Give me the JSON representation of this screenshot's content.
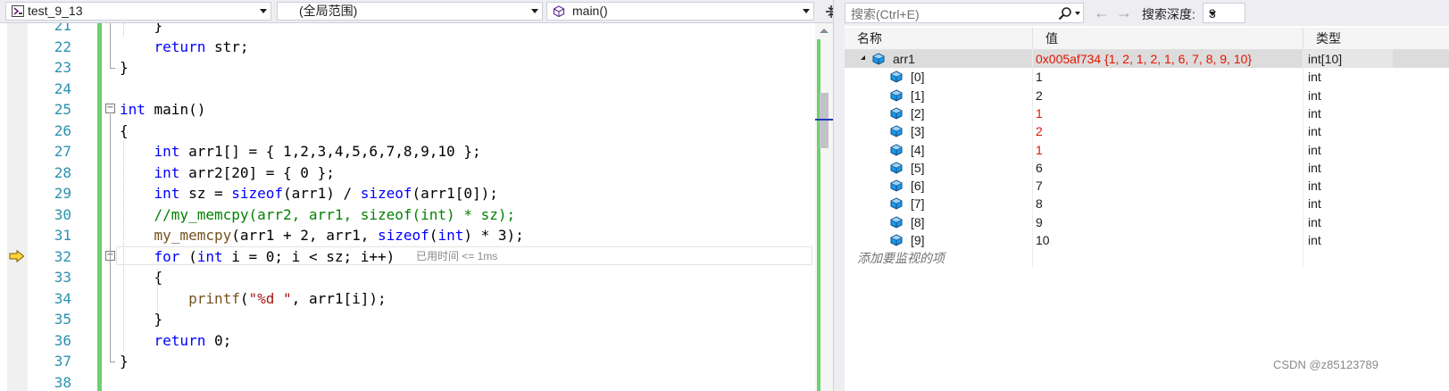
{
  "navbar": {
    "project": "test_9_13",
    "scope": "(全局范围)",
    "function": "main()"
  },
  "code": {
    "lines": [
      {
        "num": "21",
        "text": "    }",
        "partial": true
      },
      {
        "num": "22",
        "text": "    return str;"
      },
      {
        "num": "23",
        "text": "}"
      },
      {
        "num": "24",
        "text": ""
      },
      {
        "num": "25",
        "text": "int main()"
      },
      {
        "num": "26",
        "text": "{"
      },
      {
        "num": "27",
        "text": "    int arr1[] = { 1,2,3,4,5,6,7,8,9,10 };"
      },
      {
        "num": "28",
        "text": "    int arr2[20] = { 0 };"
      },
      {
        "num": "29",
        "text": "    int sz = sizeof(arr1) / sizeof(arr1[0]);"
      },
      {
        "num": "30",
        "text": "    //my_memcpy(arr2, arr1, sizeof(int) * sz);"
      },
      {
        "num": "31",
        "text": "    my_memcpy(arr1 + 2, arr1, sizeof(int) * 3);"
      },
      {
        "num": "32",
        "text": "    for (int i = 0; i < sz; i++)"
      },
      {
        "num": "33",
        "text": "    {"
      },
      {
        "num": "34",
        "text": "        printf(\"%d \", arr1[i]);"
      },
      {
        "num": "35",
        "text": "    }"
      },
      {
        "num": "36",
        "text": "    return 0;"
      },
      {
        "num": "37",
        "text": "}"
      },
      {
        "num": "38",
        "text": "",
        "partial": true
      }
    ],
    "current_line": "32",
    "perf_tip": "已用时间 <= 1ms"
  },
  "watch": {
    "search_placeholder": "搜索(Ctrl+E)",
    "depth_label": "搜索深度:",
    "depth_value": "3",
    "columns": {
      "name": "名称",
      "value": "值",
      "type": "类型"
    },
    "root": {
      "name": "arr1",
      "value": "0x005af734 {1, 2, 1, 2, 1, 6, 7, 8, 9, 10}",
      "type": "int[10]",
      "changed": true
    },
    "items": [
      {
        "name": "[0]",
        "value": "1",
        "type": "int",
        "changed": false
      },
      {
        "name": "[1]",
        "value": "2",
        "type": "int",
        "changed": false
      },
      {
        "name": "[2]",
        "value": "1",
        "type": "int",
        "changed": true
      },
      {
        "name": "[3]",
        "value": "2",
        "type": "int",
        "changed": true
      },
      {
        "name": "[4]",
        "value": "1",
        "type": "int",
        "changed": true
      },
      {
        "name": "[5]",
        "value": "6",
        "type": "int",
        "changed": false
      },
      {
        "name": "[6]",
        "value": "7",
        "type": "int",
        "changed": false
      },
      {
        "name": "[7]",
        "value": "8",
        "type": "int",
        "changed": false
      },
      {
        "name": "[8]",
        "value": "9",
        "type": "int",
        "changed": false
      },
      {
        "name": "[9]",
        "value": "10",
        "type": "int",
        "changed": false
      }
    ],
    "add_watch": "添加要监视的项"
  },
  "watermark": "CSDN @z85123789",
  "colors": {
    "changed_value": "#e51400",
    "keyword": "#0000ff",
    "comment": "#008000",
    "line_number": "#2b91af",
    "change_bar": "#6fd06f"
  }
}
